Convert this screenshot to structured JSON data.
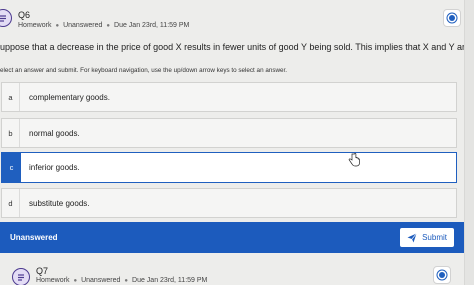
{
  "q6": {
    "title": "Q6",
    "type": "Homework",
    "status": "Unanswered",
    "due": "Due Jan 23rd, 11:59 PM"
  },
  "question": {
    "prompt": "uppose that a decrease in the price of good X results in fewer units of good Y being sold. This implies that X and Y are",
    "instructions": "elect an answer and submit. For keyboard navigation, use the up/down arrow keys to select an answer."
  },
  "options": [
    {
      "letter": "a",
      "text": "complementary goods."
    },
    {
      "letter": "b",
      "text": "normal goods."
    },
    {
      "letter": "c",
      "text": "inferior goods."
    },
    {
      "letter": "d",
      "text": "substitute goods."
    }
  ],
  "selected_option": "c",
  "footer": {
    "status": "Unanswered",
    "submit_label": "Submit"
  },
  "q7": {
    "title": "Q7",
    "type": "Homework",
    "status": "Unanswered",
    "due": "Due Jan 23rd, 11:59 PM"
  },
  "colors": {
    "accent": "#1c5bbd",
    "background": "#ededeb",
    "icon_fill": "#e3dcf5",
    "icon_stroke": "#4c3a8f"
  },
  "icons": [
    "question-list-icon",
    "status-dot-icon",
    "paper-plane-icon",
    "hand-cursor-icon"
  ]
}
